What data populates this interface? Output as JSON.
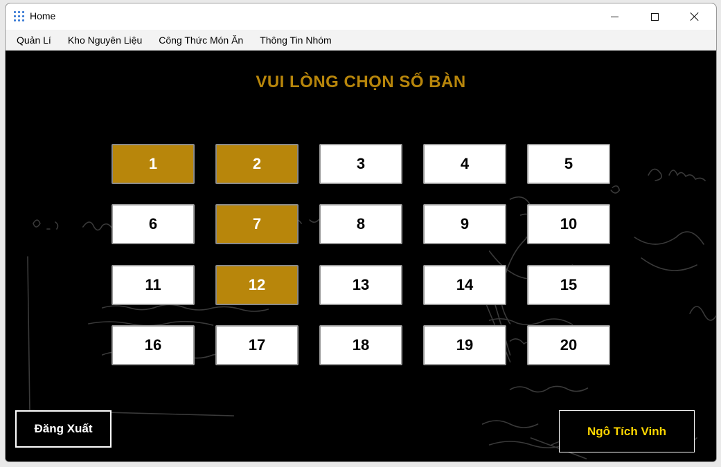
{
  "window": {
    "title": "Home",
    "accent": "#b8860b"
  },
  "menu": {
    "items": [
      "Quản Lí",
      "Kho Nguyên Liệu",
      "Công Thức Món Ăn",
      "Thông Tin Nhóm"
    ]
  },
  "main": {
    "heading": "VUI LÒNG CHỌN SỐ BÀN",
    "tables": [
      {
        "label": "1",
        "occupied": true
      },
      {
        "label": "2",
        "occupied": true
      },
      {
        "label": "3",
        "occupied": false
      },
      {
        "label": "4",
        "occupied": false
      },
      {
        "label": "5",
        "occupied": false
      },
      {
        "label": "6",
        "occupied": false
      },
      {
        "label": "7",
        "occupied": true
      },
      {
        "label": "8",
        "occupied": false
      },
      {
        "label": "9",
        "occupied": false
      },
      {
        "label": "10",
        "occupied": false
      },
      {
        "label": "11",
        "occupied": false
      },
      {
        "label": "12",
        "occupied": true
      },
      {
        "label": "13",
        "occupied": false
      },
      {
        "label": "14",
        "occupied": false
      },
      {
        "label": "15",
        "occupied": false
      },
      {
        "label": "16",
        "occupied": false
      },
      {
        "label": "17",
        "occupied": false
      },
      {
        "label": "18",
        "occupied": false
      },
      {
        "label": "19",
        "occupied": false
      },
      {
        "label": "20",
        "occupied": false
      }
    ],
    "occupied_color": "#b8860b",
    "free_color": "#ffffff"
  },
  "footer": {
    "logout_label": "Đăng Xuất",
    "user_name": "Ngô Tích Vinh",
    "user_color": "#ffd700"
  }
}
